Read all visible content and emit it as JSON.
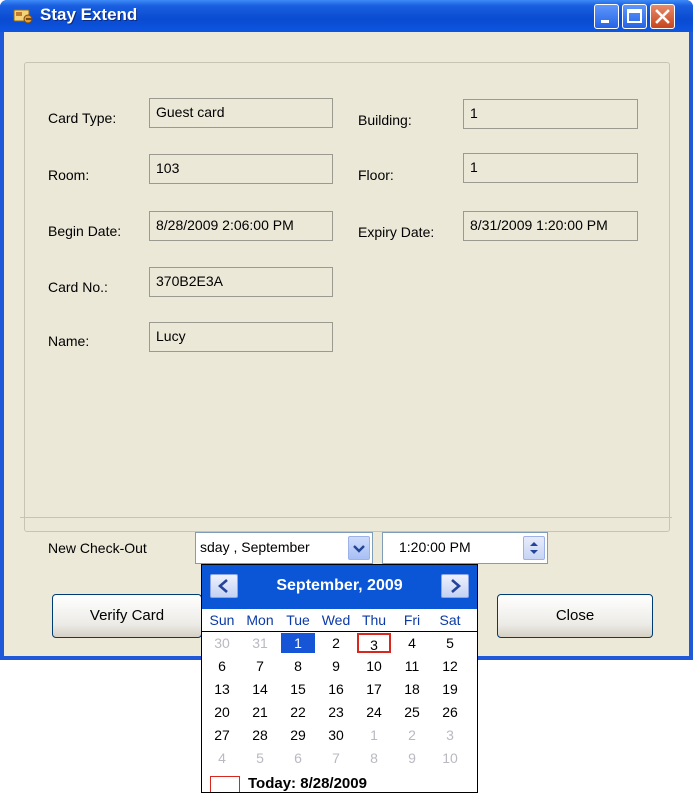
{
  "window": {
    "title": "Stay Extend",
    "icon": "key-card-icon"
  },
  "form": {
    "card_type_label": "Card Type:",
    "card_type_value": "Guest card",
    "building_label": "Building:",
    "building_value": "1",
    "room_label": "Room:",
    "room_value": "103",
    "floor_label": "Floor:",
    "floor_value": "1",
    "begin_date_label": "Begin Date:",
    "begin_date_value": "8/28/2009 2:06:00 PM",
    "expiry_date_label": "Expiry Date:",
    "expiry_date_value": "8/31/2009 1:20:00 PM",
    "card_no_label": "Card No.:",
    "card_no_value": "370B2E3A",
    "name_label": "Name:",
    "name_value": "Lucy"
  },
  "checkout": {
    "label": "New Check-Out",
    "date_value": "sday  , September",
    "time_value": "1:20:00 PM"
  },
  "buttons": {
    "verify_card": "Verify Card",
    "close": "Close"
  },
  "calendar": {
    "title": "September, 2009",
    "days_of_week": [
      "Sun",
      "Mon",
      "Tue",
      "Wed",
      "Thu",
      "Fri",
      "Sat"
    ],
    "weeks": [
      [
        "30",
        "31",
        "1",
        "2",
        "3",
        "4",
        "5"
      ],
      [
        "6",
        "7",
        "8",
        "9",
        "10",
        "11",
        "12"
      ],
      [
        "13",
        "14",
        "15",
        "16",
        "17",
        "18",
        "19"
      ],
      [
        "20",
        "21",
        "22",
        "23",
        "24",
        "25",
        "26"
      ],
      [
        "27",
        "28",
        "29",
        "30",
        "1",
        "2",
        "3"
      ],
      [
        "4",
        "5",
        "6",
        "7",
        "8",
        "9",
        "10"
      ]
    ],
    "muted_cells": [
      [
        0,
        0
      ],
      [
        0,
        1
      ],
      [
        4,
        4
      ],
      [
        4,
        5
      ],
      [
        4,
        6
      ],
      [
        5,
        0
      ],
      [
        5,
        1
      ],
      [
        5,
        2
      ],
      [
        5,
        3
      ],
      [
        5,
        4
      ],
      [
        5,
        5
      ],
      [
        5,
        6
      ]
    ],
    "selected_cell": [
      0,
      2
    ],
    "highlight_cell": [
      0,
      4
    ],
    "today_label": "Today: 8/28/2009"
  },
  "colors": {
    "title_bar": "#0a4bd1",
    "window_bg": "#ece9d8",
    "calendar_header": "#0b56d6",
    "selected_day": "#1656d6",
    "highlight_border": "#d8281e"
  }
}
